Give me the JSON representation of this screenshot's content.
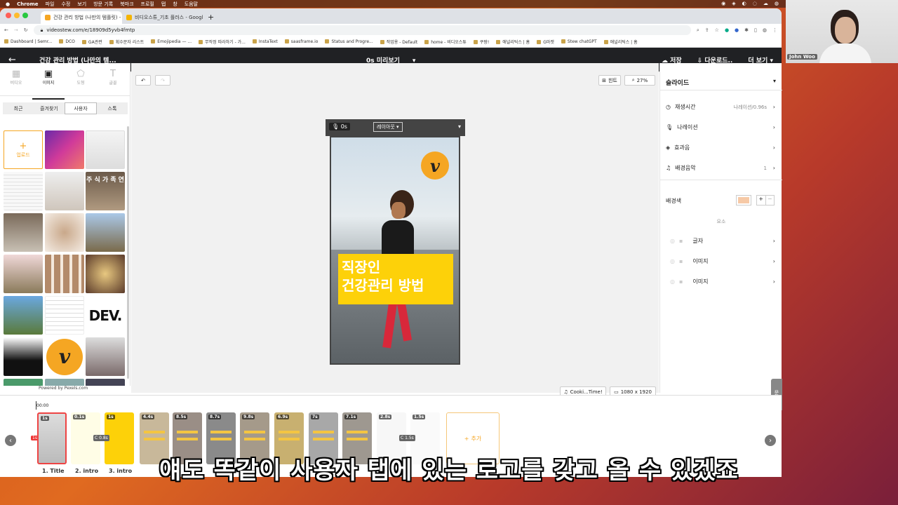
{
  "macbar": {
    "items": [
      "Chrome",
      "파일",
      "수정",
      "보기",
      "방문 기록",
      "북마크",
      "프로필",
      "탭",
      "창",
      "도움말"
    ]
  },
  "browser": {
    "tabs": [
      {
        "title": "건강 관리 방법 (나만의 템플릿) - Dc"
      },
      {
        "title": "비디오스튜_기초 플러스 - Googl"
      }
    ],
    "url": "videostew.com/e/18909d5yvb4fmtp",
    "bookmarks": [
      "Dashboard | Semr...",
      "DCO",
      "GA관련",
      "획수문자 리스트",
      "Emojipedia — ...",
      "무작정 따라하기 - 가...",
      "InstaText",
      "saasframe.io",
      "Status and Progre...",
      "작업용 - Default",
      "home - 비디오스튜",
      "쿠팡!",
      "애널리틱스 | 홈",
      "G마켓",
      "Stew chatGPT",
      "애널리틱스 | 홈"
    ]
  },
  "header": {
    "title": "건강 관리 방법 (나만의 템...",
    "preview_time": "0s",
    "preview_label": "미리보기",
    "save": "저장",
    "download": "다운로드..",
    "more": "더 보기"
  },
  "left": {
    "tabs": [
      "비디오",
      "이미지",
      "도형",
      "글꼴"
    ],
    "subtabs": [
      "최근",
      "즐겨찾기",
      "사용자",
      "스톡"
    ],
    "upload": "업로드",
    "footer": "Powered by Pexels.com",
    "thumb_texts": {
      "text_a": "주 식 가 족 연",
      "text_b": "DEV."
    }
  },
  "canvas": {
    "hint": "힌트",
    "zoom": "27%",
    "time": "0s",
    "layout": "레이아웃",
    "slide_text_1": "직장인",
    "slide_text_2": "건강관리 방법",
    "music": "Cooki...Time!",
    "size": "1080 x 1920",
    "logo_letter": "v"
  },
  "right": {
    "title": "슬라이드",
    "rows": [
      {
        "label": "재생시간",
        "value": "나레이션/0.96s"
      },
      {
        "label": "나레이션",
        "value": ""
      },
      {
        "label": "효과음",
        "value": ""
      },
      {
        "label": "배경음악",
        "value": "1"
      }
    ],
    "bgcolor_label": "배경색",
    "bgcolor": "#f6c9a6",
    "elements_label": "요소",
    "elements": [
      "글자",
      "이미지",
      "이미지"
    ],
    "side_tab": "문의"
  },
  "timeline": {
    "time": "00:00",
    "slides": [
      {
        "badge": "1s",
        "label": "1. Title"
      },
      {
        "badge": "0.1s",
        "label": "2. intro"
      },
      {
        "badge": "1s",
        "label": "3. intro"
      },
      {
        "badge": "4.4s",
        "label": ""
      },
      {
        "badge": "8.5s",
        "label": ""
      },
      {
        "badge": "8.7s",
        "label": ""
      },
      {
        "badge": "9.8s",
        "label": ""
      },
      {
        "badge": "6.9s",
        "label": ""
      },
      {
        "badge": "7s",
        "label": ""
      },
      {
        "badge": "7.1s",
        "label": ""
      },
      {
        "badge": "2.8s",
        "label": ""
      },
      {
        "badge": "1.5s",
        "label": ""
      }
    ],
    "trans1": "C 0.8s",
    "trans2": "C 1.5s",
    "playhead_badge": "1s",
    "add": "추가"
  },
  "subtitle": "얘도 똑같이 사용자 탭에 있는 로고를 갖고 올 수 있겠죠",
  "webcam": {
    "name": "John Woo"
  }
}
